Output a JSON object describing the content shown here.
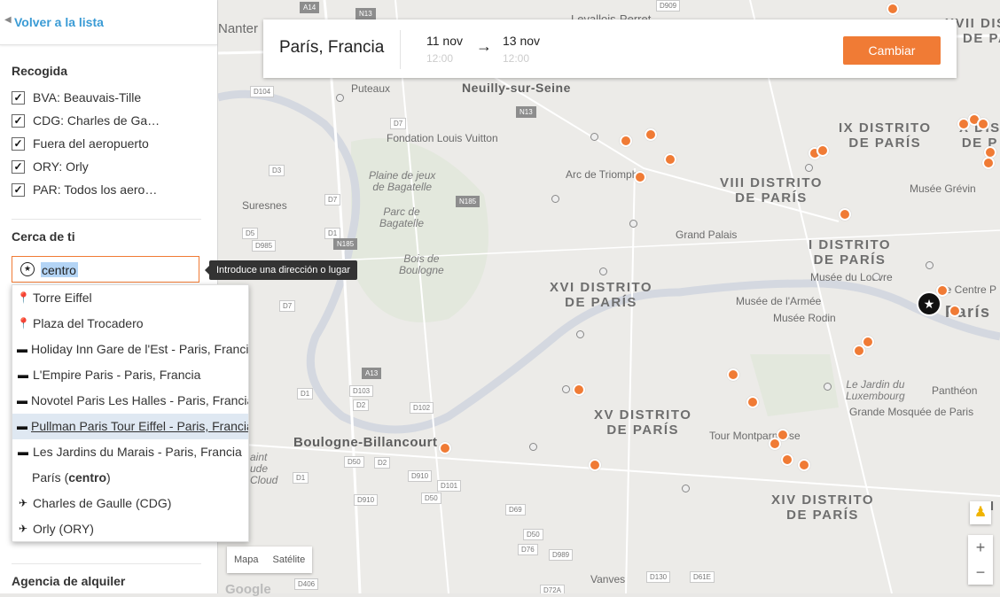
{
  "sidebar": {
    "back_link": "Volver a la lista",
    "pickup": {
      "title": "Recogida",
      "options": [
        {
          "label": "BVA: Beauvais-Tille",
          "checked": true
        },
        {
          "label": "CDG: Charles de Ga…",
          "checked": true
        },
        {
          "label": "Fuera del aeropuerto",
          "checked": true
        },
        {
          "label": "ORY: Orly",
          "checked": true
        },
        {
          "label": "PAR: Todos los aero…",
          "checked": true
        }
      ]
    },
    "near": {
      "title": "Cerca de ti",
      "search_value": "centro",
      "tooltip": "Introduce una dirección o lugar"
    },
    "suggestions": [
      {
        "icon": "map-pin-icon",
        "glyph": "⚲",
        "label": "Torre Eiffel"
      },
      {
        "icon": "map-pin-icon",
        "glyph": "⚲",
        "label": "Plaza del Trocadero"
      },
      {
        "icon": "hotel-icon",
        "glyph": "🛏",
        "label": "Holiday Inn Gare de l'Est - Paris, Francia"
      },
      {
        "icon": "hotel-icon",
        "glyph": "🛏",
        "label": "L'Empire Paris - Paris, Francia"
      },
      {
        "icon": "hotel-icon",
        "glyph": "🛏",
        "label": "Novotel Paris Les Halles - Paris, Francia"
      },
      {
        "icon": "hotel-icon",
        "glyph": "🛏",
        "label": "Pullman Paris Tour Eiffel - Paris, Francia",
        "active": true
      },
      {
        "icon": "hotel-icon",
        "glyph": "🛏",
        "label": "Les Jardins du Marais - Paris, Francia"
      },
      {
        "icon": "",
        "glyph": "",
        "label_prefix": "París (",
        "label_bold": "centro",
        "label_suffix": ")"
      },
      {
        "icon": "airplane-icon",
        "glyph": "✈",
        "label": "Charles de Gaulle (CDG)"
      },
      {
        "icon": "airplane-icon",
        "glyph": "✈",
        "label": "Orly (ORY)"
      }
    ],
    "rental_title": "Agencia de alquiler"
  },
  "topcard": {
    "location": "París, Francia",
    "from_date": "11 nov",
    "from_time": "12:00",
    "arrow": "→",
    "to_date": "13 nov",
    "to_time": "12:00",
    "button": "Cambiar"
  },
  "map": {
    "type_buttons": [
      "Mapa",
      "Satélite"
    ],
    "zoom_in": "+",
    "zoom_out": "−",
    "logo": "Google",
    "labels": {
      "nanterre": "Nanter",
      "puteaux": "Puteaux",
      "neuilly": "Neuilly-sur-Seine",
      "levallois": "Levallois-Perret",
      "fondation": "Fondation Louis Vuitton",
      "arc": "Arc de Triomphe",
      "plaine": "Plaine de jeux\nde Bagatelle",
      "parc": "Parc de\nBagatelle",
      "suresnes": "Suresnes",
      "bois": "Bois de\nBoulogne",
      "xvi": "XVI DISTRITO\nDE PARÍS",
      "viii": "VIII DISTRITO\nDE PARÍS",
      "ix": "IX DISTRITO\nDE PARÍS",
      "x": "X DIS\nDE P",
      "xvii": "XVII DISTRITO\nDE PARÍS",
      "i": "I DISTRITO\nDE PARÍS",
      "grevin": "Musée Grévin",
      "grand": "Grand Palais",
      "louvre": "Musée du Louvre",
      "armee": "Musée de l'Armée",
      "rodin": "Musée Rodin",
      "centre": "Le Centre P",
      "paris": "París",
      "xv": "XV DISTRITO\nDE PARÍS",
      "jardin": "Le Jardin du\nLuxembourg",
      "pantheon": "Panthéon",
      "mosquee": "Grande Mosquée de Paris",
      "boulogne": "Boulogne-Billancourt",
      "tour": "Tour Montparnasse",
      "xiv": "XIV DISTRITO\nDE PARÍS",
      "xiii": "XIII",
      "cloud": "aint\nude\nCloud",
      "vanves": "Vanves"
    },
    "roads": [
      "A14",
      "N13",
      "D909",
      "D104",
      "D7",
      "N13",
      "D3",
      "D7",
      "N185",
      "D1",
      "N185",
      "D5",
      "D985",
      "D7",
      "A13",
      "D1",
      "D103",
      "D2",
      "D102",
      "D50",
      "D2",
      "D910",
      "D101",
      "D50",
      "D910",
      "D69",
      "D1",
      "D50",
      "D76",
      "D989",
      "D130",
      "D61E",
      "D72A",
      "D406"
    ]
  },
  "colors": {
    "accent": "#f07b35",
    "link": "#3a9bd5",
    "selection": "#b3d4f5"
  }
}
